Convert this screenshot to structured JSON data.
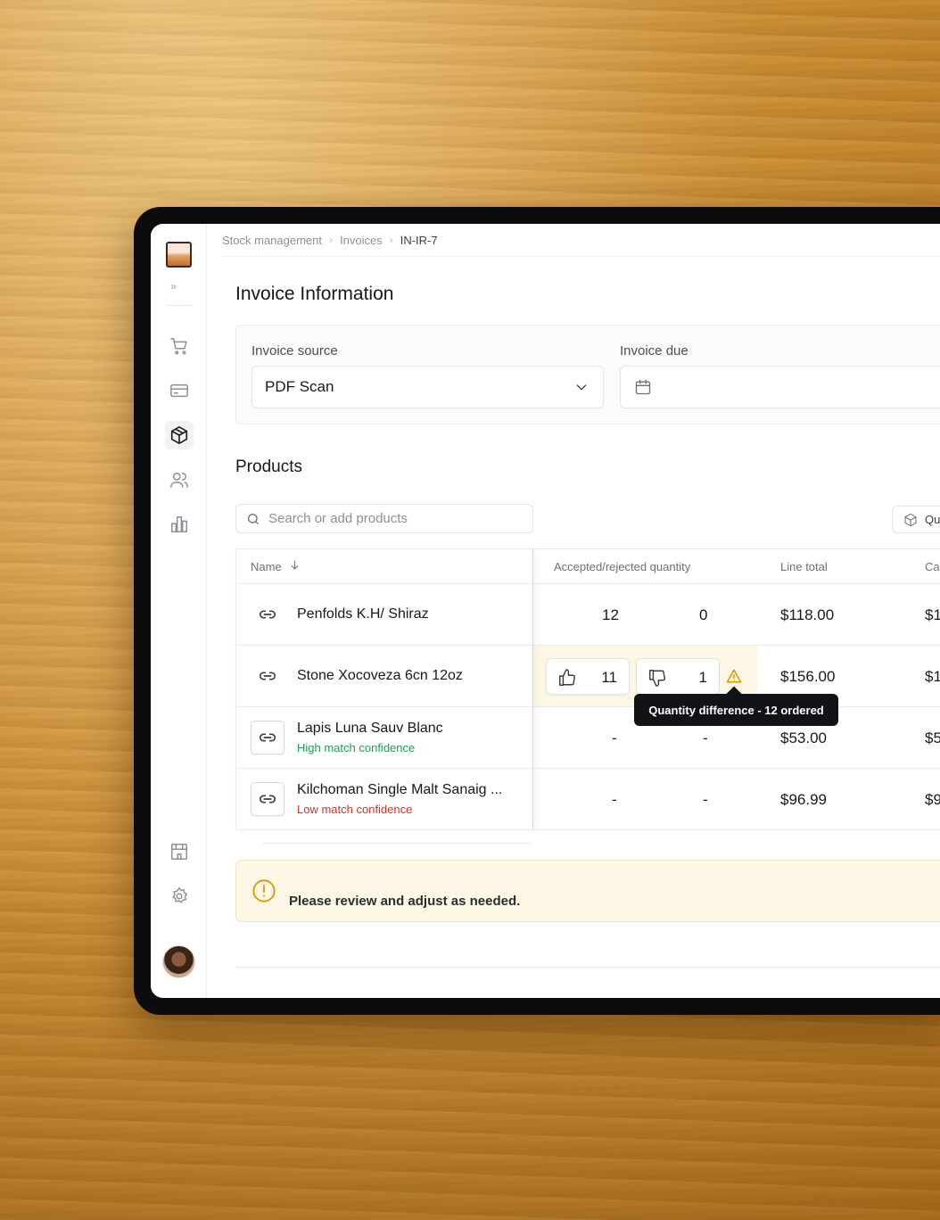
{
  "breadcrumb": [
    "Stock management",
    "Invoices",
    "IN-IR-7"
  ],
  "page_title": "Invoice Information",
  "invoice_source": {
    "label": "Invoice source",
    "value": "PDF Scan"
  },
  "invoice_due": {
    "label": "Invoice due",
    "value": ""
  },
  "products_title": "Products",
  "search": {
    "placeholder": "Search or add products"
  },
  "toolbar": {
    "qu_button_label": "Qu"
  },
  "table": {
    "headers": {
      "name": "Name",
      "accepted_rejected": "Accepted/rejected quantity",
      "line_total": "Line total",
      "ca": "Ca"
    },
    "rows": [
      {
        "name": "Penfolds K.H/ Shiraz",
        "confidence": "",
        "accepted": "12",
        "rejected": "0",
        "line_total": "$118.00",
        "ca": "$1"
      },
      {
        "name": "Stone Xocoveza 6cn 12oz",
        "confidence": "",
        "accepted": "11",
        "rejected": "1",
        "line_total": "$156.00",
        "ca": "$1"
      },
      {
        "name": "Lapis Luna Sauv Blanc",
        "confidence": "High match confidence",
        "accepted": "-",
        "rejected": "-",
        "line_total": "$53.00",
        "ca": "$5"
      },
      {
        "name": "Kilchoman Single Malt Sanaig ...",
        "confidence": "Low match confidence",
        "accepted": "-",
        "rejected": "-",
        "line_total": "$96.99",
        "ca": "$9"
      }
    ]
  },
  "tooltip": "Quantity difference - 12 ordered",
  "alert": "Please review and adjust as needed.",
  "colors": {
    "high_confidence": "#1f9d55",
    "low_confidence": "#d93025",
    "warning": "#e59400",
    "tooltip_bg": "#111317"
  },
  "icons": {
    "sidebar": [
      "expand-icon",
      "cart-icon",
      "card-icon",
      "box-icon",
      "users-icon",
      "chart-icon",
      "store-icon",
      "gear-icon"
    ]
  }
}
